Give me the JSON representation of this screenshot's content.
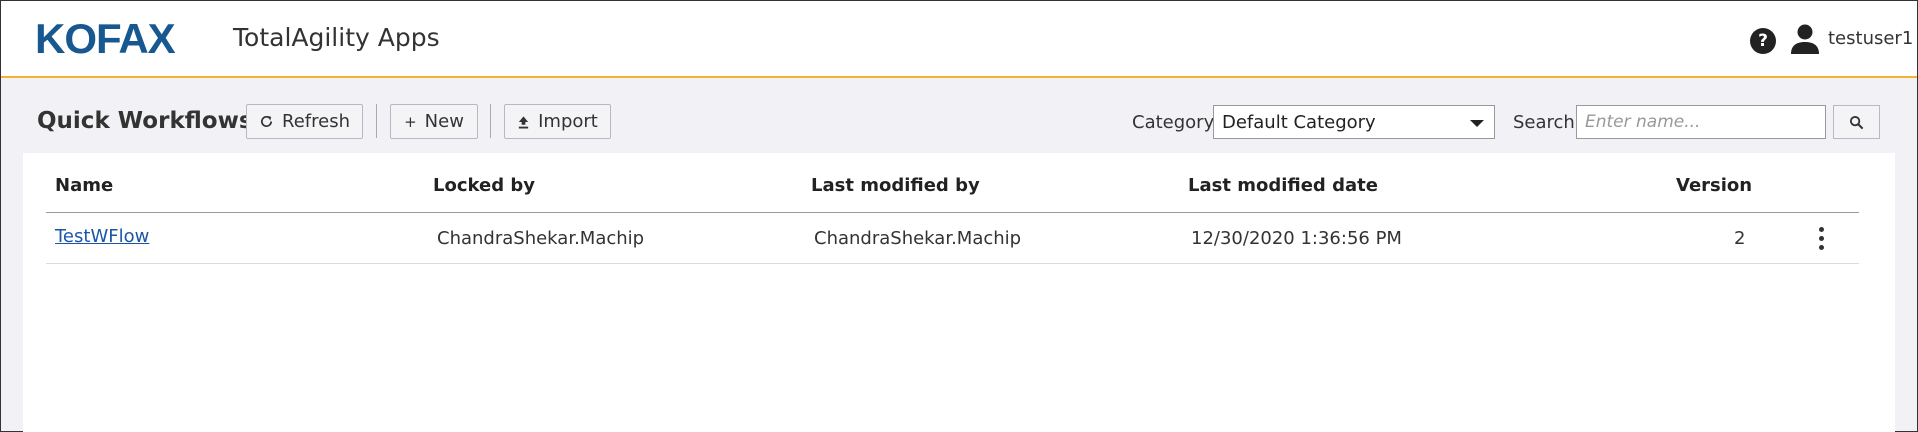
{
  "header": {
    "logo_text": "KOFAX",
    "app_title": "TotalAgility Apps",
    "help_glyph": "?",
    "username": "testuser1"
  },
  "toolbar": {
    "page_title": "Quick Workflows",
    "refresh_label": "Refresh",
    "new_label": "New",
    "import_label": "Import",
    "category_label": "Category",
    "category_selected": "Default Category",
    "search_label": "Search",
    "search_placeholder": "Enter name..."
  },
  "table": {
    "columns": [
      "Name",
      "Locked by",
      "Last modified by",
      "Last modified date",
      "Version"
    ],
    "rows": [
      {
        "name": "TestWFlow",
        "locked_by": "ChandraShekar.Machip",
        "last_modified_by": "ChandraShekar.Machip",
        "last_modified_date": "12/30/2020 1:36:56 PM",
        "version": "2"
      }
    ]
  },
  "icons": {
    "refresh": "refresh-icon",
    "new": "plus-icon",
    "import": "upload-icon",
    "search": "search-icon",
    "help": "help-icon",
    "user": "user-icon",
    "row_menu": "kebab-menu-icon"
  },
  "colors": {
    "brand": "#16588f",
    "accent_border": "#f5b335",
    "link": "#1a56a8"
  }
}
